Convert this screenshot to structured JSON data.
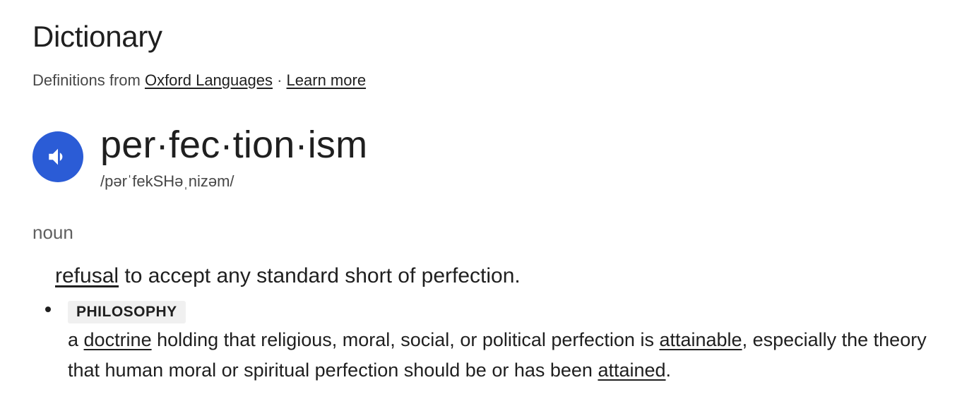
{
  "dictionary": {
    "title": "Dictionary",
    "source": {
      "prefix": "Definitions from ",
      "provider_link": "Oxford Languages",
      "separator": " · ",
      "learn_more_link": "Learn more"
    },
    "entry": {
      "headword": "per·fec·tion·ism",
      "phonetic": "/pərˈfekSHəˌnizəm/",
      "part_of_speech": "noun",
      "senses": [
        {
          "link_word": "refusal",
          "rest": " to accept any standard short of perfection."
        },
        {
          "domain": "PHILOSOPHY",
          "text_a": "a ",
          "link_a": "doctrine",
          "text_b": " holding that religious, moral, social, or political perfection is ",
          "link_b": "attainable",
          "text_c": ", especially the theory that human moral or spiritual perfection should be or has been ",
          "link_c": "attained",
          "text_d": "."
        }
      ]
    },
    "icons": {
      "audio": "speaker-icon"
    },
    "colors": {
      "audio_button": "#2b5cd6",
      "text_primary": "#1f1f1f",
      "text_secondary": "#474747",
      "badge_bg": "#f0f0f0"
    }
  }
}
